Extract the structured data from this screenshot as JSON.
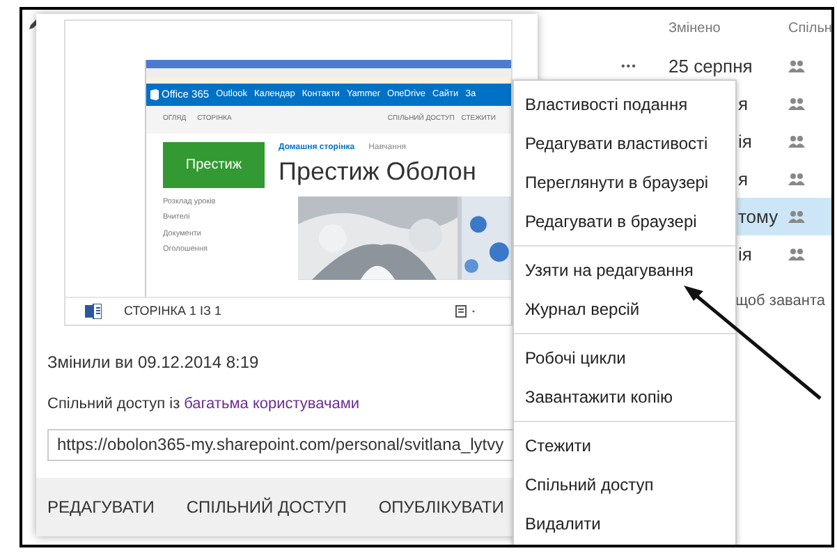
{
  "list": {
    "columns": [
      "Змінено",
      "Спільн"
    ],
    "rows": [
      {
        "modified": "25 серпня",
        "more": "•••",
        "selected": false
      },
      {
        "modified": "я",
        "selected": false
      },
      {
        "modified": "ія",
        "selected": false
      },
      {
        "modified": "я",
        "selected": false
      },
      {
        "modified": "тому",
        "selected": true
      },
      {
        "modified": "ія",
        "selected": false
      }
    ],
    "hint": "щоб заванта"
  },
  "preview": {
    "browser": {
      "brand": "Office 365",
      "links": [
        "Outlook",
        "Календар",
        "Контакти",
        "Yammer",
        "OneDrive",
        "Сайти",
        "За"
      ],
      "tabs": [
        "ОГЛЯД",
        "СТОРІНКА"
      ],
      "actions": [
        "СПІЛЬНИЙ ДОСТУП",
        "СТЕЖИТИ"
      ],
      "tile": "Престиж",
      "breadcrumbs": [
        {
          "label": "Домашня сторінка",
          "selected": true
        },
        {
          "label": "Навчання",
          "selected": false
        }
      ],
      "site_title": "Престиж Оболон",
      "nav": [
        "Розклад уроків",
        "Вчителі",
        "Документи",
        "Оголошення"
      ]
    },
    "page_indicator": "СТОРІНКА 1 ІЗ 1"
  },
  "modified": "Змінили ви 09.12.2014 8:19",
  "sharing": {
    "text": "Спільний доступ із",
    "link": "багатьма користувачами"
  },
  "url": "https://obolon365-my.sharepoint.com/personal/svitlana_lytvy",
  "actions": [
    "РЕДАГУВАТИ",
    "СПІЛЬНИЙ ДОСТУП",
    "ОПУБЛІКУВАТИ"
  ],
  "context_menu": [
    [
      "Властивості подання",
      "Редагувати властивості",
      "Переглянути в браузері",
      "Редагувати в браузері"
    ],
    [
      "Узяти на редагування",
      "Журнал версій"
    ],
    [
      "Робочі цикли",
      "Завантажити копію"
    ],
    [
      "Стежити",
      "Спільний доступ",
      "Видалити"
    ]
  ]
}
